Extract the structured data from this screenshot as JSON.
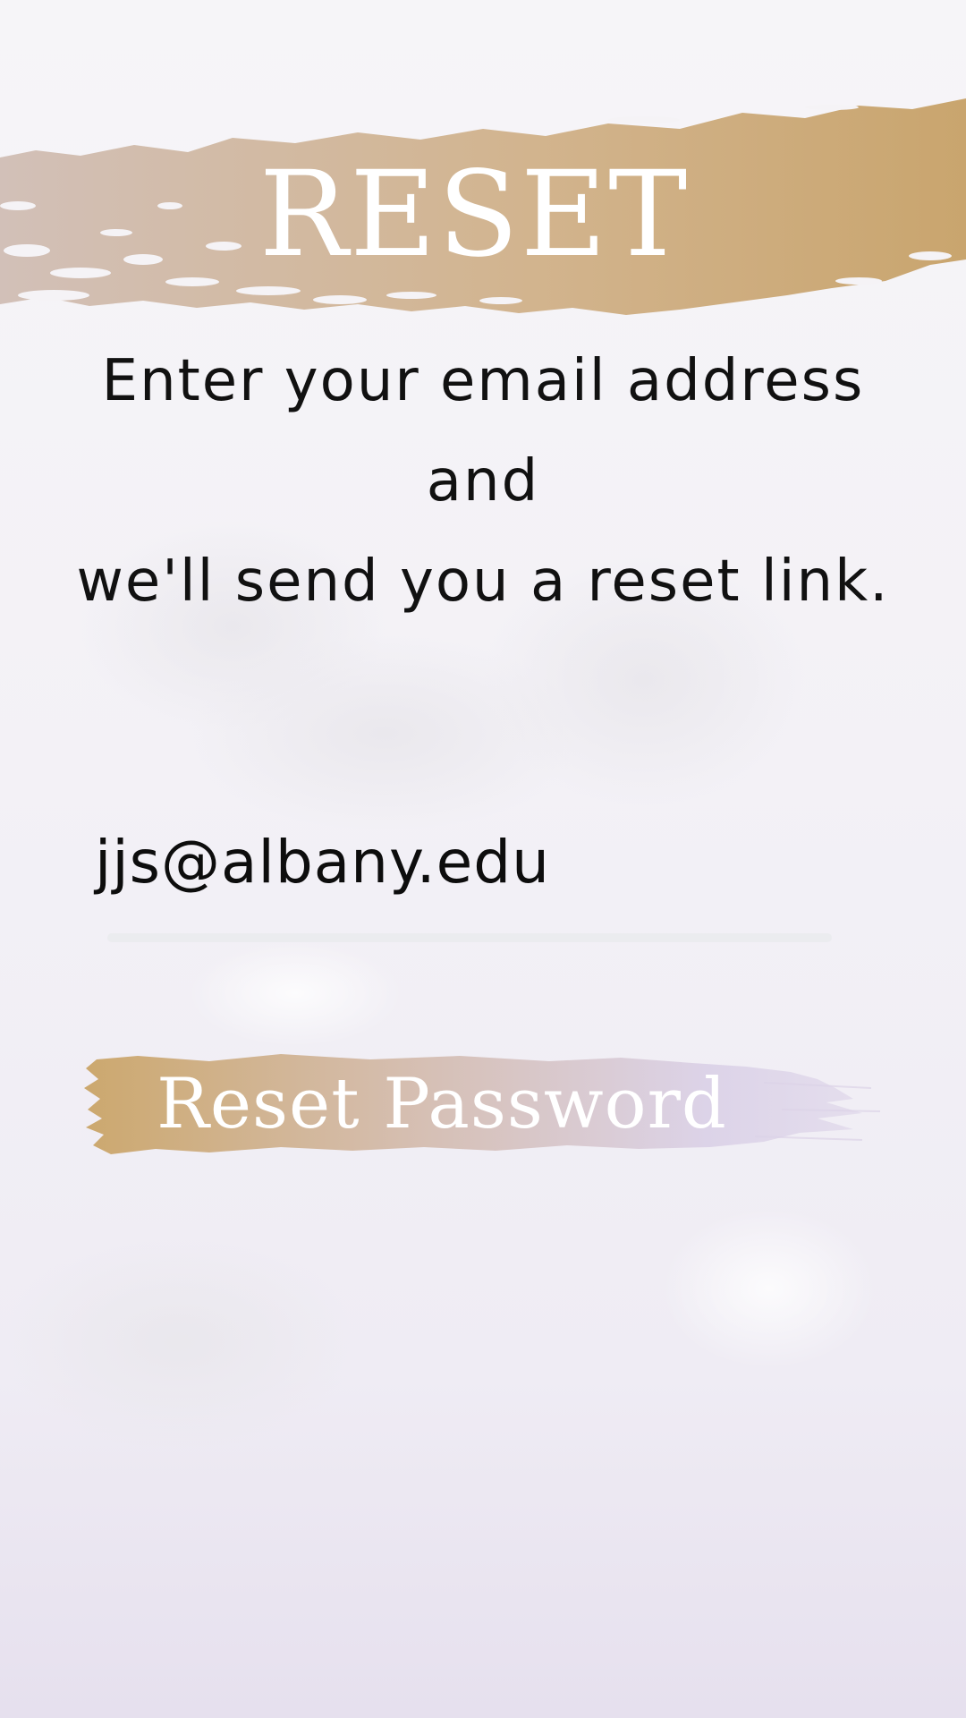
{
  "header": {
    "title": "RESET"
  },
  "instructions": {
    "line1": "Enter your email address and",
    "line2": "we'll send you a reset link."
  },
  "email_field": {
    "value": "jjs@albany.edu"
  },
  "reset_button": {
    "label": "Reset Password"
  },
  "colors": {
    "gold": "#c9a56e",
    "mauve": "#d6c4c4",
    "lavender": "#dcd3e8",
    "title_text": "#ffffff",
    "body_text": "#111111"
  }
}
